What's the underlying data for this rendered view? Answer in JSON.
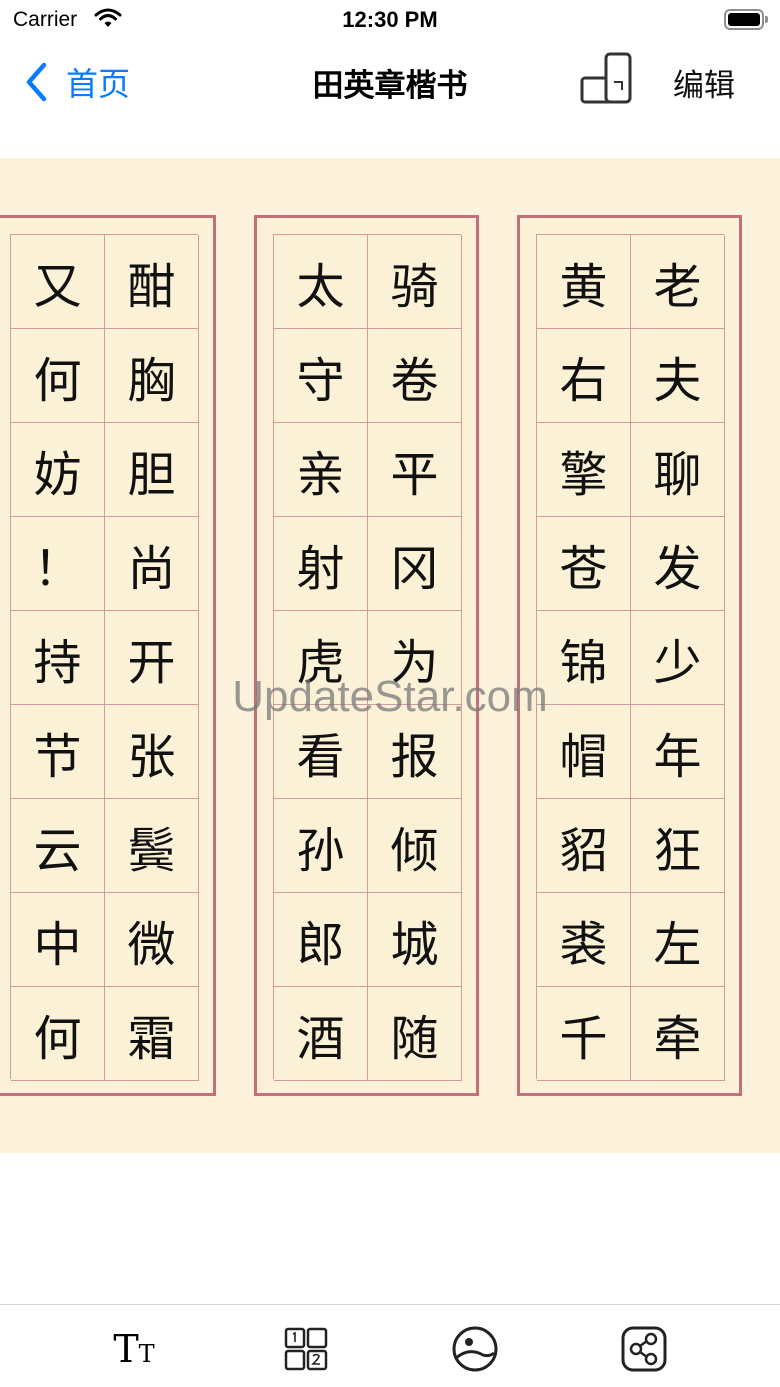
{
  "status_bar": {
    "carrier": "Carrier",
    "time": "12:30 PM"
  },
  "nav": {
    "back_label": "首页",
    "title": "田英章楷书",
    "edit_label": "编辑",
    "accent_color": "#0a7aff"
  },
  "columns": [
    {
      "cells": [
        "又",
        "酣",
        "何",
        "胸",
        "妨",
        "胆",
        "！",
        "尚",
        "持",
        "开",
        "节",
        "张",
        "云",
        "鬓",
        "中",
        "微",
        "何",
        "霜"
      ]
    },
    {
      "cells": [
        "太",
        "骑",
        "守",
        "卷",
        "亲",
        "平",
        "射",
        "冈",
        "虎",
        "为",
        "看",
        "报",
        "孙",
        "倾",
        "郎",
        "城",
        "酒",
        "随"
      ]
    },
    {
      "cells": [
        "黄",
        "老",
        "右",
        "夫",
        "擎",
        "聊",
        "苍",
        "发",
        "锦",
        "少",
        "帽",
        "年",
        "貂",
        "狂",
        "裘",
        "左",
        "千",
        "牵"
      ]
    }
  ],
  "watermark": "UpdateStar.com",
  "toolbar": {
    "font_big": "T",
    "font_small": "T",
    "icons": [
      "font-size-icon",
      "grid-layout-icon",
      "background-style-icon",
      "share-icon"
    ]
  },
  "colors": {
    "paper": "#fdf3dc",
    "frame": "#c4707a",
    "grid_line": "#cf9aa0"
  }
}
